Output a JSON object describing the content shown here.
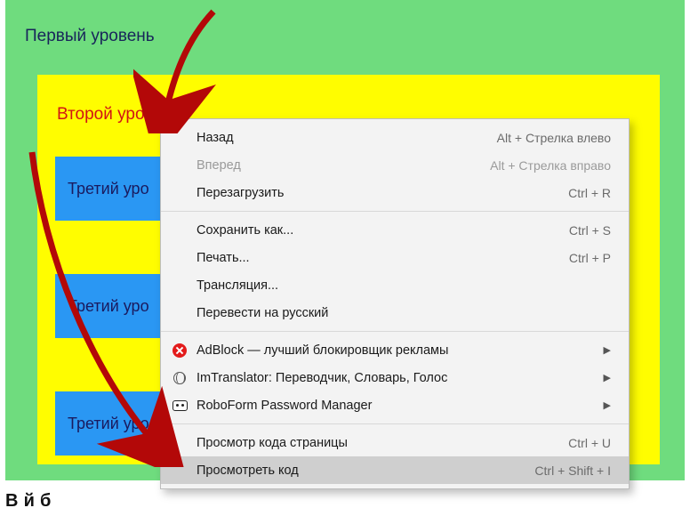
{
  "page": {
    "level1_label": "Первый уровень",
    "level2_label": "Второй уровен",
    "level3_label": "Третий уро",
    "below_fragment": "В     й              б"
  },
  "context_menu": {
    "groups": [
      [
        {
          "label": "Назад",
          "hint": "Alt + Стрелка влево",
          "disabled": false
        },
        {
          "label": "Вперед",
          "hint": "Alt + Стрелка вправо",
          "disabled": true
        },
        {
          "label": "Перезагрузить",
          "hint": "Ctrl + R",
          "disabled": false
        }
      ],
      [
        {
          "label": "Сохранить как...",
          "hint": "Ctrl + S"
        },
        {
          "label": "Печать...",
          "hint": "Ctrl + P"
        },
        {
          "label": "Трансляция...",
          "hint": ""
        },
        {
          "label": "Перевести на русский",
          "hint": ""
        }
      ],
      [
        {
          "label": "AdBlock — лучший блокировщик рекламы",
          "icon": "adblock",
          "submenu": true
        },
        {
          "label": "ImTranslator: Переводчик, Словарь, Голос",
          "icon": "translator",
          "submenu": true
        },
        {
          "label": "RoboForm Password Manager",
          "icon": "roboform",
          "submenu": true
        }
      ],
      [
        {
          "label": "Просмотр кода страницы",
          "hint": "Ctrl + U"
        },
        {
          "label": "Просмотреть код",
          "hint": "Ctrl + Shift + I",
          "hovered": true
        }
      ]
    ],
    "submenu_caret": "▶"
  }
}
